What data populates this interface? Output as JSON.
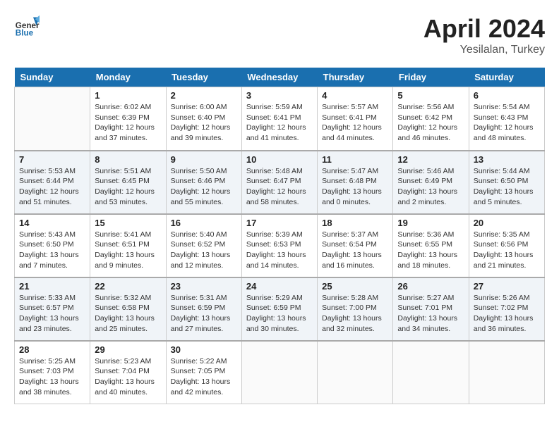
{
  "header": {
    "logo_general": "General",
    "logo_blue": "Blue",
    "title": "April 2024",
    "subtitle": "Yesilalan, Turkey"
  },
  "weekdays": [
    "Sunday",
    "Monday",
    "Tuesday",
    "Wednesday",
    "Thursday",
    "Friday",
    "Saturday"
  ],
  "weeks": [
    [
      {
        "day": "",
        "info": ""
      },
      {
        "day": "1",
        "info": "Sunrise: 6:02 AM\nSunset: 6:39 PM\nDaylight: 12 hours\nand 37 minutes."
      },
      {
        "day": "2",
        "info": "Sunrise: 6:00 AM\nSunset: 6:40 PM\nDaylight: 12 hours\nand 39 minutes."
      },
      {
        "day": "3",
        "info": "Sunrise: 5:59 AM\nSunset: 6:41 PM\nDaylight: 12 hours\nand 41 minutes."
      },
      {
        "day": "4",
        "info": "Sunrise: 5:57 AM\nSunset: 6:41 PM\nDaylight: 12 hours\nand 44 minutes."
      },
      {
        "day": "5",
        "info": "Sunrise: 5:56 AM\nSunset: 6:42 PM\nDaylight: 12 hours\nand 46 minutes."
      },
      {
        "day": "6",
        "info": "Sunrise: 5:54 AM\nSunset: 6:43 PM\nDaylight: 12 hours\nand 48 minutes."
      }
    ],
    [
      {
        "day": "7",
        "info": "Sunrise: 5:53 AM\nSunset: 6:44 PM\nDaylight: 12 hours\nand 51 minutes."
      },
      {
        "day": "8",
        "info": "Sunrise: 5:51 AM\nSunset: 6:45 PM\nDaylight: 12 hours\nand 53 minutes."
      },
      {
        "day": "9",
        "info": "Sunrise: 5:50 AM\nSunset: 6:46 PM\nDaylight: 12 hours\nand 55 minutes."
      },
      {
        "day": "10",
        "info": "Sunrise: 5:48 AM\nSunset: 6:47 PM\nDaylight: 12 hours\nand 58 minutes."
      },
      {
        "day": "11",
        "info": "Sunrise: 5:47 AM\nSunset: 6:48 PM\nDaylight: 13 hours\nand 0 minutes."
      },
      {
        "day": "12",
        "info": "Sunrise: 5:46 AM\nSunset: 6:49 PM\nDaylight: 13 hours\nand 2 minutes."
      },
      {
        "day": "13",
        "info": "Sunrise: 5:44 AM\nSunset: 6:50 PM\nDaylight: 13 hours\nand 5 minutes."
      }
    ],
    [
      {
        "day": "14",
        "info": "Sunrise: 5:43 AM\nSunset: 6:50 PM\nDaylight: 13 hours\nand 7 minutes."
      },
      {
        "day": "15",
        "info": "Sunrise: 5:41 AM\nSunset: 6:51 PM\nDaylight: 13 hours\nand 9 minutes."
      },
      {
        "day": "16",
        "info": "Sunrise: 5:40 AM\nSunset: 6:52 PM\nDaylight: 13 hours\nand 12 minutes."
      },
      {
        "day": "17",
        "info": "Sunrise: 5:39 AM\nSunset: 6:53 PM\nDaylight: 13 hours\nand 14 minutes."
      },
      {
        "day": "18",
        "info": "Sunrise: 5:37 AM\nSunset: 6:54 PM\nDaylight: 13 hours\nand 16 minutes."
      },
      {
        "day": "19",
        "info": "Sunrise: 5:36 AM\nSunset: 6:55 PM\nDaylight: 13 hours\nand 18 minutes."
      },
      {
        "day": "20",
        "info": "Sunrise: 5:35 AM\nSunset: 6:56 PM\nDaylight: 13 hours\nand 21 minutes."
      }
    ],
    [
      {
        "day": "21",
        "info": "Sunrise: 5:33 AM\nSunset: 6:57 PM\nDaylight: 13 hours\nand 23 minutes."
      },
      {
        "day": "22",
        "info": "Sunrise: 5:32 AM\nSunset: 6:58 PM\nDaylight: 13 hours\nand 25 minutes."
      },
      {
        "day": "23",
        "info": "Sunrise: 5:31 AM\nSunset: 6:59 PM\nDaylight: 13 hours\nand 27 minutes."
      },
      {
        "day": "24",
        "info": "Sunrise: 5:29 AM\nSunset: 6:59 PM\nDaylight: 13 hours\nand 30 minutes."
      },
      {
        "day": "25",
        "info": "Sunrise: 5:28 AM\nSunset: 7:00 PM\nDaylight: 13 hours\nand 32 minutes."
      },
      {
        "day": "26",
        "info": "Sunrise: 5:27 AM\nSunset: 7:01 PM\nDaylight: 13 hours\nand 34 minutes."
      },
      {
        "day": "27",
        "info": "Sunrise: 5:26 AM\nSunset: 7:02 PM\nDaylight: 13 hours\nand 36 minutes."
      }
    ],
    [
      {
        "day": "28",
        "info": "Sunrise: 5:25 AM\nSunset: 7:03 PM\nDaylight: 13 hours\nand 38 minutes."
      },
      {
        "day": "29",
        "info": "Sunrise: 5:23 AM\nSunset: 7:04 PM\nDaylight: 13 hours\nand 40 minutes."
      },
      {
        "day": "30",
        "info": "Sunrise: 5:22 AM\nSunset: 7:05 PM\nDaylight: 13 hours\nand 42 minutes."
      },
      {
        "day": "",
        "info": ""
      },
      {
        "day": "",
        "info": ""
      },
      {
        "day": "",
        "info": ""
      },
      {
        "day": "",
        "info": ""
      }
    ]
  ]
}
